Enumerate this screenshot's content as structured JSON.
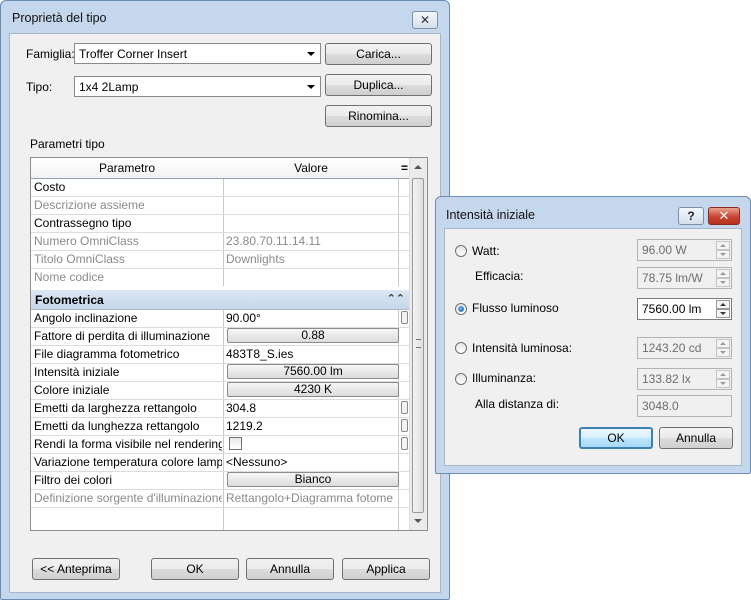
{
  "main": {
    "title": "Proprietà del tipo",
    "close_symbol": "✕",
    "famiglia_label": "Famiglia:",
    "famiglia_value": "Troffer Corner Insert",
    "tipo_label": "Tipo:",
    "tipo_value": "1x4 2Lamp",
    "carica_label": "Carica...",
    "duplica_label": "Duplica...",
    "rinomina_label": "Rinomina...",
    "section_label": "Parametri tipo",
    "col_param": "Parametro",
    "col_value": "Valore",
    "col_sort": "=",
    "rows_top": [
      {
        "param": "Costo",
        "value": "",
        "disabled": false
      },
      {
        "param": "Descrizione assieme",
        "value": "",
        "disabled": true
      },
      {
        "param": "Contrassegno tipo",
        "value": "",
        "disabled": false
      },
      {
        "param": "Numero OmniClass",
        "value": "23.80.70.11.14.11",
        "disabled": true
      },
      {
        "param": "Titolo OmniClass",
        "value": "Downlights",
        "disabled": true
      },
      {
        "param": "Nome codice",
        "value": "",
        "disabled": true
      }
    ],
    "group_label": "Fotometrica",
    "group_toggle": "⌃⌃",
    "rows_photo": {
      "angolo_p": "Angolo inclinazione",
      "angolo_v": "90.00°",
      "perdita_p": "Fattore di perdita di illuminazione",
      "perdita_v": "0.88",
      "file_p": "File diagramma fotometrico",
      "file_v": "483T8_S.ies",
      "intens_p": "Intensità iniziale",
      "intens_v": "7560.00 lm",
      "colore_p": "Colore iniziale",
      "colore_v": "4230 K",
      "larg_p": "Emetti da larghezza rettangolo",
      "larg_v": "304.8",
      "lung_p": "Emetti da lunghezza rettangolo",
      "lung_v": "1219.2",
      "rendi_p": "Rendi la forma visibile nel rendering",
      "variaz_p": "Variazione temperatura colore lamp",
      "variaz_v": "<Nessuno>",
      "filtro_p": "Filtro dei colori",
      "filtro_v": "Bianco",
      "defin_p": "Definizione sorgente d'illuminazione",
      "defin_v": "Rettangolo+Diagramma fotome"
    },
    "anteprima_label": "<< Anteprima",
    "ok_label": "OK",
    "annulla_label": "Annulla",
    "applica_label": "Applica"
  },
  "dialog": {
    "title": "Intensità iniziale",
    "help_symbol": "?",
    "close_symbol": "✕",
    "watt_label": "Watt:",
    "watt_value": "96.00 W",
    "efficacia_label": "Efficacia:",
    "efficacia_value": "78.75 lm/W",
    "flusso_label": "Flusso luminoso",
    "flusso_value": "7560.00 lm",
    "intensita_label": "Intensità luminosa:",
    "intensita_value": "1243.20 cd",
    "illuminanza_label": "Illuminanza:",
    "illuminanza_value": "133.82 lx",
    "distanza_label": "Alla distanza di:",
    "distanza_value": "3048.0",
    "ok_label": "OK",
    "annulla_label": "Annulla"
  }
}
